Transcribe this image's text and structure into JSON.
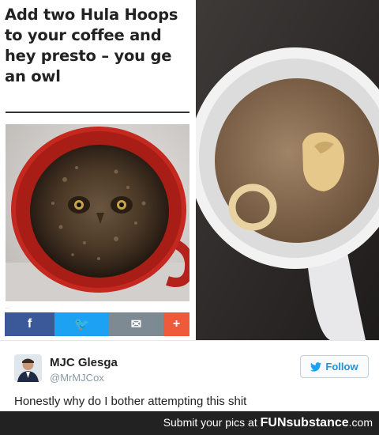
{
  "article": {
    "heading": "Add two Hula Hoops\nto your coffee and\nhey presto – you ge\nan owl"
  },
  "share": {
    "facebook_icon": "f",
    "twitter_icon": "🐦",
    "email_icon": "✉",
    "more_icon": "+"
  },
  "tweet": {
    "name": "MJC Glesga",
    "handle": "@MrMJCox",
    "follow_label": "Follow",
    "text": "Honestly why do I bother attempting this shit"
  },
  "footer": {
    "prefix": "Submit your pics at ",
    "brand": "FUNsubstance",
    "suffix": ".com"
  }
}
